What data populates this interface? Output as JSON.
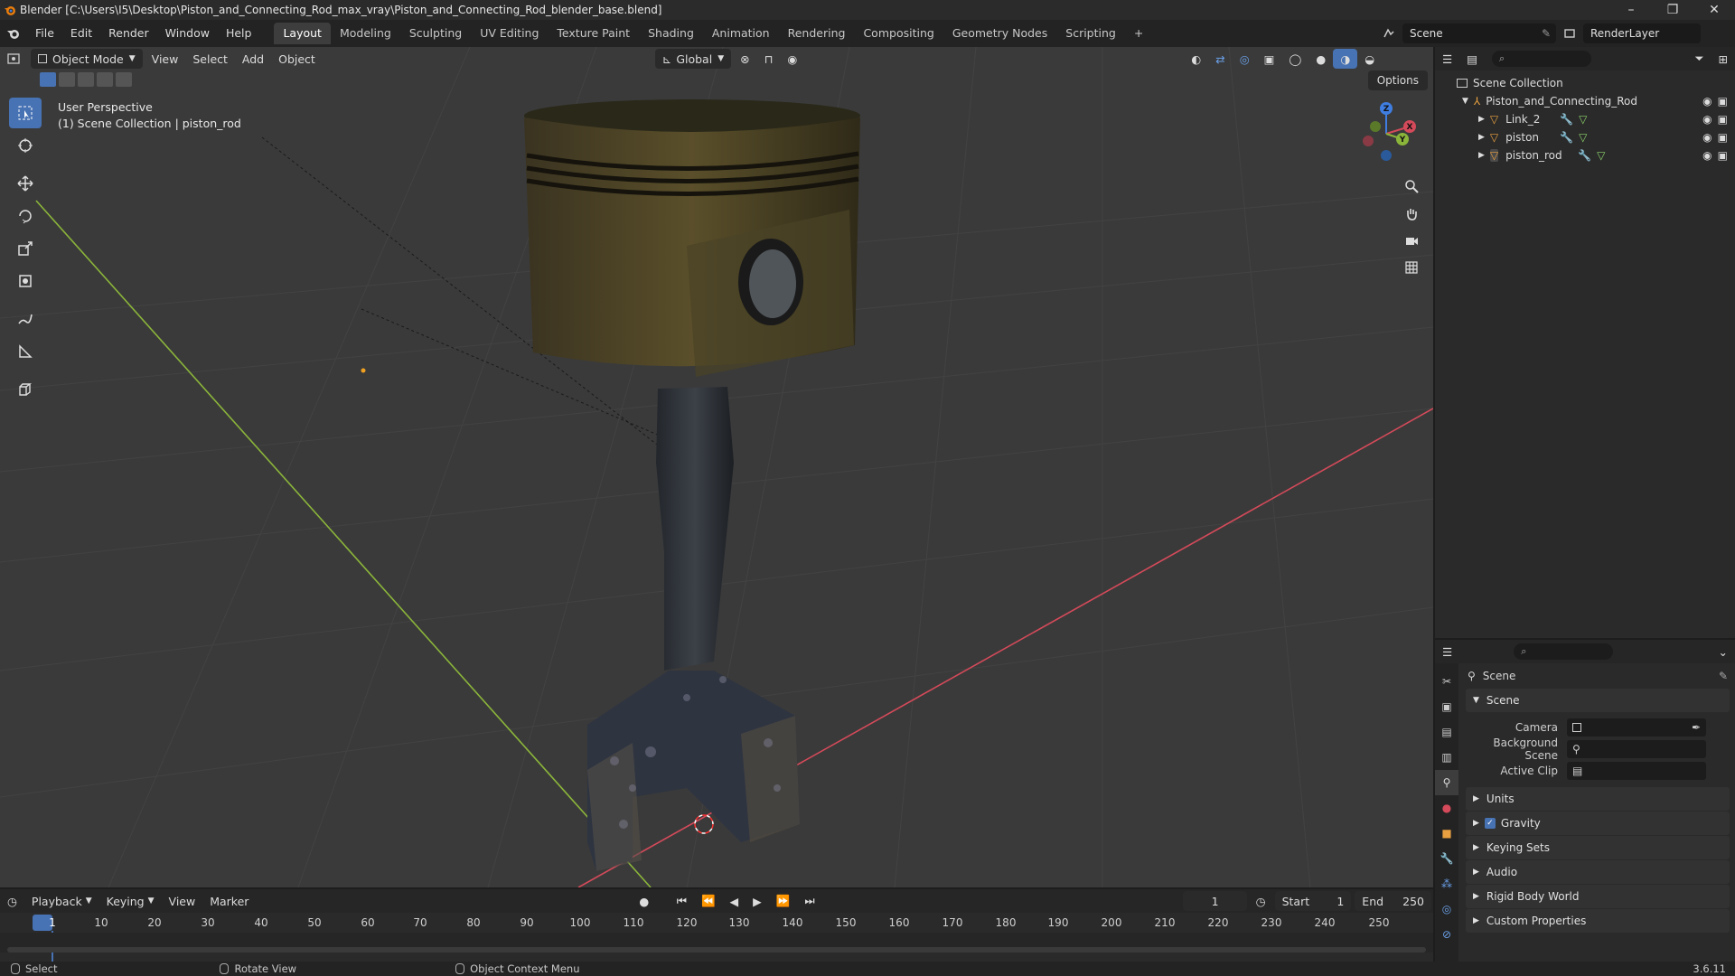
{
  "window": {
    "title": "Blender [C:\\Users\\I5\\Desktop\\Piston_and_Connecting_Rod_max_vray\\Piston_and_Connecting_Rod_blender_base.blend]",
    "minimize": "–",
    "maximize": "❐",
    "close": "✕"
  },
  "menu": [
    "File",
    "Edit",
    "Render",
    "Window",
    "Help"
  ],
  "workspaces": [
    "Layout",
    "Modeling",
    "Sculpting",
    "UV Editing",
    "Texture Paint",
    "Shading",
    "Animation",
    "Rendering",
    "Compositing",
    "Geometry Nodes",
    "Scripting"
  ],
  "active_workspace": "Layout",
  "add_workspace": "+",
  "scene_name": "Scene",
  "view_layer": "RenderLayer",
  "viewport": {
    "mode": "Object Mode",
    "menus": [
      "View",
      "Select",
      "Add",
      "Object"
    ],
    "orientation": "Global",
    "options": "Options",
    "info_line1": "User Perspective",
    "info_line2": "(1) Scene Collection | piston_rod",
    "gizmo_axes": {
      "x": "X",
      "y": "Y",
      "z": "Z"
    }
  },
  "outliner": {
    "root": "Scene Collection",
    "collection": "Piston_and_Connecting_Rod",
    "objects": [
      "Link_2",
      "piston",
      "piston_rod"
    ]
  },
  "properties": {
    "context": "Scene",
    "panel": "Scene",
    "fields": [
      {
        "label": "Camera",
        "value": ""
      },
      {
        "label": "Background Scene",
        "value": ""
      },
      {
        "label": "Active Clip",
        "value": ""
      }
    ],
    "sections": [
      "Units",
      "Gravity",
      "Keying Sets",
      "Audio",
      "Rigid Body World",
      "Custom Properties"
    ],
    "gravity_checked": true
  },
  "timeline": {
    "menus": [
      "Playback",
      "Keying",
      "View",
      "Marker"
    ],
    "current_frame": "1",
    "start_label": "Start",
    "start": "1",
    "end_label": "End",
    "end": "250",
    "ticks": [
      "1",
      "10",
      "20",
      "30",
      "40",
      "50",
      "60",
      "70",
      "80",
      "90",
      "100",
      "110",
      "120",
      "130",
      "140",
      "150",
      "160",
      "170",
      "180",
      "190",
      "200",
      "210",
      "220",
      "230",
      "240",
      "250"
    ]
  },
  "statusbar": {
    "select": "Select",
    "rotate": "Rotate View",
    "context_menu": "Object Context Menu",
    "version": "3.6.11"
  },
  "colors": {
    "accent": "#4772b3",
    "x_axis": "#d44a5a",
    "y_axis": "#8bb53a",
    "z_axis": "#3f7ee0",
    "playhead": "#4772b3"
  }
}
